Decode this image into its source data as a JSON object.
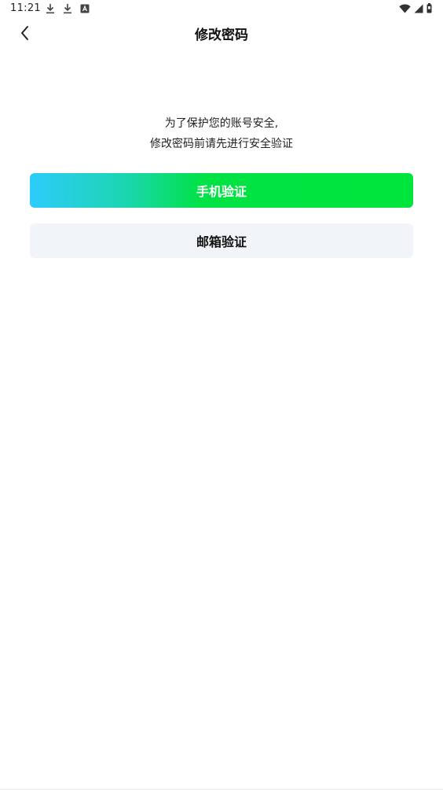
{
  "status_bar": {
    "time": "11:21",
    "left_icons": [
      "download-icon",
      "download-icon",
      "app-icon"
    ],
    "right_icons": [
      "wifi-icon",
      "signal-icon",
      "battery-icon"
    ]
  },
  "header": {
    "title": "修改密码",
    "back_icon": "chevron-left-icon"
  },
  "notice": {
    "line1": "为了保护您的账号安全,",
    "line2": "修改密码前请先进行安全验证"
  },
  "actions": {
    "phone_label": "手机验证",
    "email_label": "邮箱验证"
  },
  "colors": {
    "gradient_start": "#2dcbfb",
    "gradient_end": "#00e53c",
    "secondary_bg": "#f1f4f8"
  }
}
